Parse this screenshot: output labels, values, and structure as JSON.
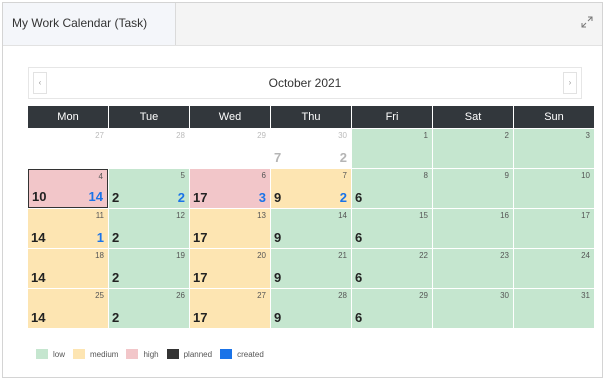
{
  "widget": {
    "title": "My Work Calendar (Task)"
  },
  "calendar": {
    "month_label": "October 2021",
    "prev_glyph": "‹",
    "next_glyph": "›",
    "weekdays": [
      "Mon",
      "Tue",
      "Wed",
      "Thu",
      "Fri",
      "Sat",
      "Sun"
    ],
    "weeks": [
      [
        {
          "day": "27",
          "level": "outside",
          "planned": "",
          "created": ""
        },
        {
          "day": "28",
          "level": "outside",
          "planned": "",
          "created": ""
        },
        {
          "day": "29",
          "level": "outside",
          "planned": "",
          "created": ""
        },
        {
          "day": "30",
          "level": "outside",
          "planned": "7",
          "created": "2"
        },
        {
          "day": "1",
          "level": "low",
          "planned": "",
          "created": ""
        },
        {
          "day": "2",
          "level": "low",
          "planned": "",
          "created": ""
        },
        {
          "day": "3",
          "level": "low",
          "planned": "",
          "created": ""
        }
      ],
      [
        {
          "day": "4",
          "level": "high",
          "planned": "10",
          "created": "14",
          "today": true
        },
        {
          "day": "5",
          "level": "low",
          "planned": "2",
          "created": "2"
        },
        {
          "day": "6",
          "level": "high",
          "planned": "17",
          "created": "3"
        },
        {
          "day": "7",
          "level": "medium",
          "planned": "9",
          "created": "2"
        },
        {
          "day": "8",
          "level": "low",
          "planned": "6",
          "created": ""
        },
        {
          "day": "9",
          "level": "low",
          "planned": "",
          "created": ""
        },
        {
          "day": "10",
          "level": "low",
          "planned": "",
          "created": ""
        }
      ],
      [
        {
          "day": "11",
          "level": "medium",
          "planned": "14",
          "created": "1"
        },
        {
          "day": "12",
          "level": "low",
          "planned": "2",
          "created": ""
        },
        {
          "day": "13",
          "level": "medium",
          "planned": "17",
          "created": ""
        },
        {
          "day": "14",
          "level": "low",
          "planned": "9",
          "created": ""
        },
        {
          "day": "15",
          "level": "low",
          "planned": "6",
          "created": ""
        },
        {
          "day": "16",
          "level": "low",
          "planned": "",
          "created": ""
        },
        {
          "day": "17",
          "level": "low",
          "planned": "",
          "created": ""
        }
      ],
      [
        {
          "day": "18",
          "level": "medium",
          "planned": "14",
          "created": ""
        },
        {
          "day": "19",
          "level": "low",
          "planned": "2",
          "created": ""
        },
        {
          "day": "20",
          "level": "medium",
          "planned": "17",
          "created": ""
        },
        {
          "day": "21",
          "level": "low",
          "planned": "9",
          "created": ""
        },
        {
          "day": "22",
          "level": "low",
          "planned": "6",
          "created": ""
        },
        {
          "day": "23",
          "level": "low",
          "planned": "",
          "created": ""
        },
        {
          "day": "24",
          "level": "low",
          "planned": "",
          "created": ""
        }
      ],
      [
        {
          "day": "25",
          "level": "medium",
          "planned": "14",
          "created": ""
        },
        {
          "day": "26",
          "level": "low",
          "planned": "2",
          "created": ""
        },
        {
          "day": "27",
          "level": "medium",
          "planned": "17",
          "created": ""
        },
        {
          "day": "28",
          "level": "low",
          "planned": "9",
          "created": ""
        },
        {
          "day": "29",
          "level": "low",
          "planned": "6",
          "created": ""
        },
        {
          "day": "30",
          "level": "low",
          "planned": "",
          "created": ""
        },
        {
          "day": "31",
          "level": "low",
          "planned": "",
          "created": ""
        }
      ]
    ]
  },
  "legend": [
    {
      "label": "low",
      "color": "#c5e6cf"
    },
    {
      "label": "medium",
      "color": "#fde5b2"
    },
    {
      "label": "high",
      "color": "#f2c6c9"
    },
    {
      "label": "planned",
      "color": "#333333"
    },
    {
      "label": "created",
      "color": "#1a73e8"
    }
  ],
  "icons": {
    "expand": "expand-icon",
    "prev": "chevron-left-icon",
    "next": "chevron-right-icon"
  }
}
